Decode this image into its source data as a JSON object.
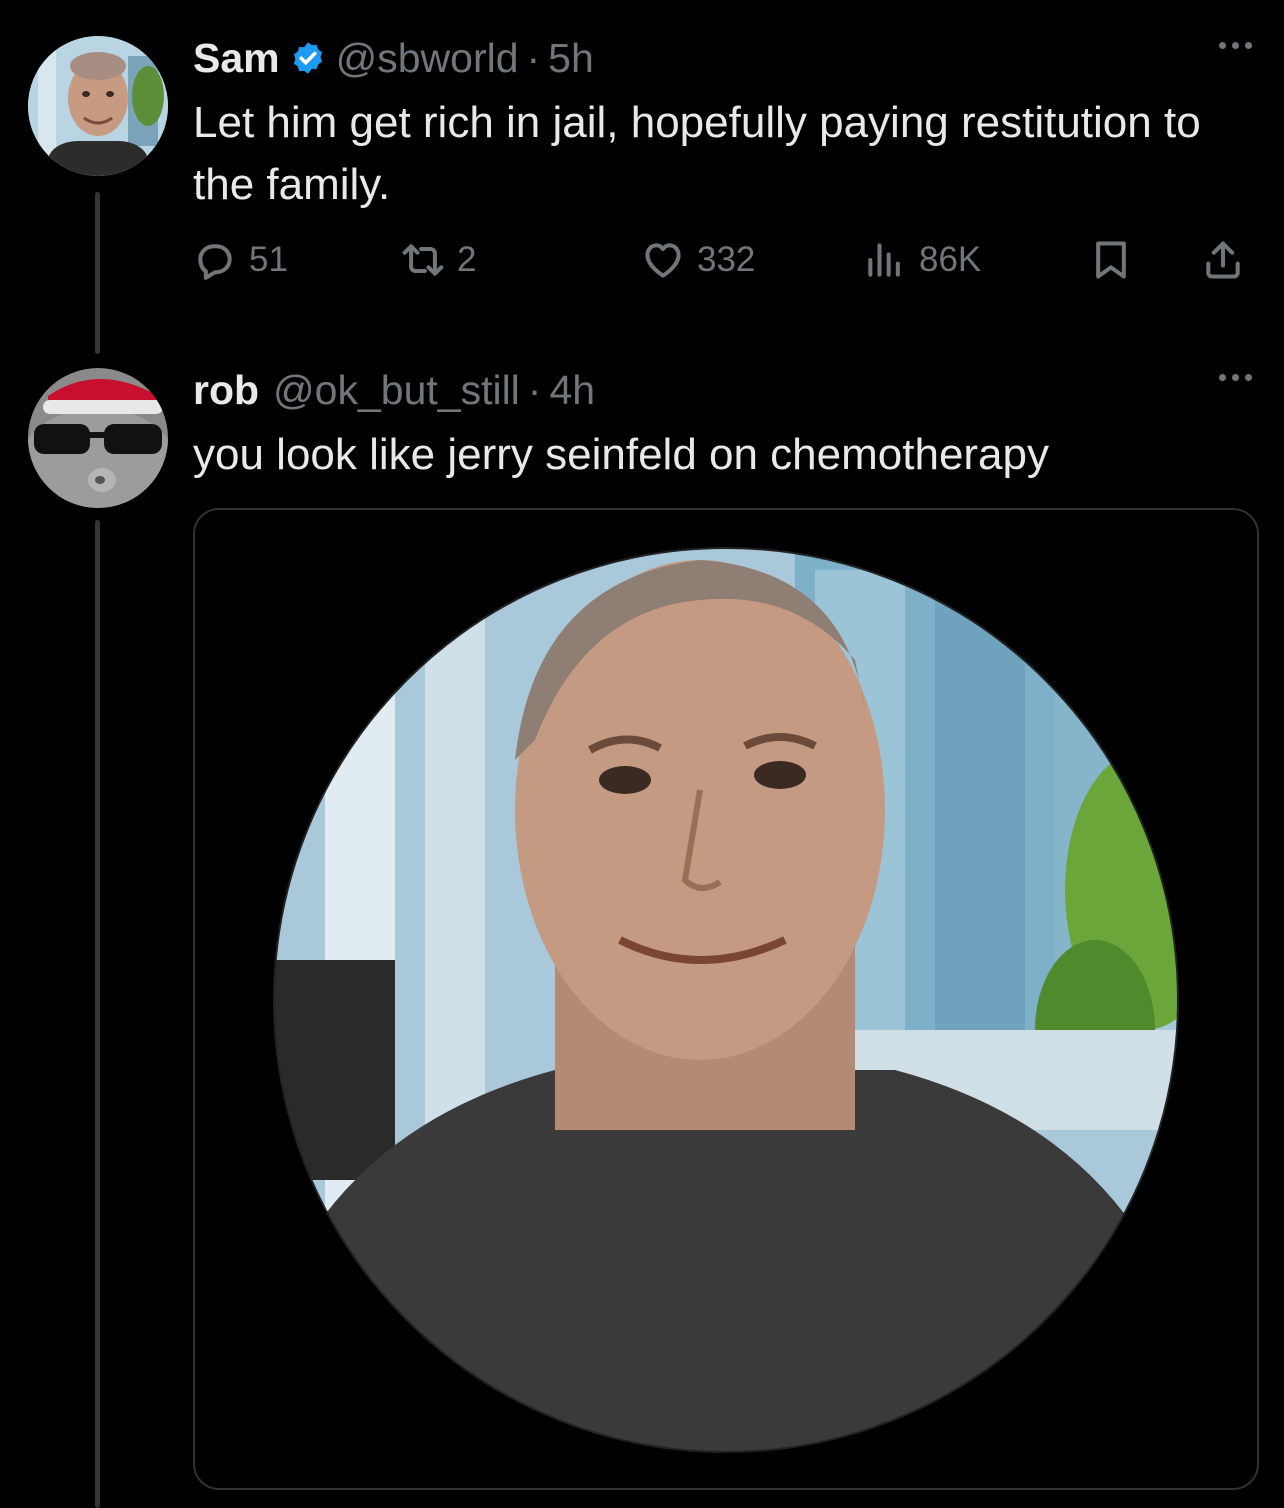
{
  "thread": {
    "tweets": [
      {
        "name": "Sam",
        "verified": true,
        "handle": "@sbworld",
        "separator": "·",
        "time": "5h",
        "text": "Let him get rich in jail, hopefully paying restitution to the family.",
        "actions": {
          "replies": "51",
          "retweets": "2",
          "likes": "332",
          "views": "86K"
        }
      },
      {
        "name": "rob",
        "verified": false,
        "handle": "@ok_but_still",
        "separator": "·",
        "time": "4h",
        "text": "you look like jerry seinfeld on chemotherapy"
      }
    ]
  },
  "icons": {
    "verified": "verified-badge-icon",
    "more": "more-dots-icon",
    "reply": "reply-icon",
    "retweet": "retweet-icon",
    "like": "heart-icon",
    "views": "views-icon",
    "bookmark": "bookmark-icon",
    "share": "share-icon"
  },
  "colors": {
    "background": "#000000",
    "text_primary": "#e7e9ea",
    "text_secondary": "#71767b",
    "verified_blue": "#1d9bf0",
    "border": "#2f3336"
  }
}
